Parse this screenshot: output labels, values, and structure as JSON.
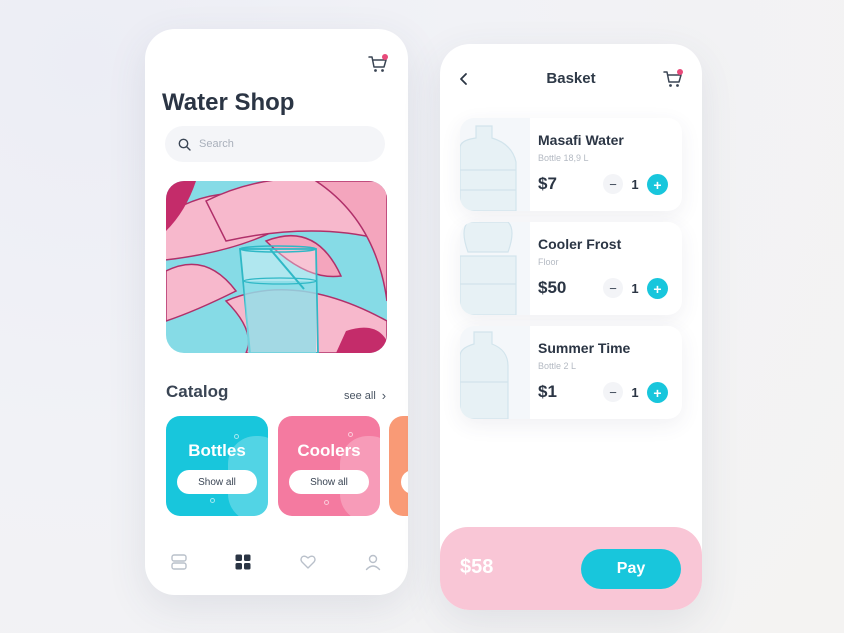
{
  "shop": {
    "title": "Water Shop",
    "search_placeholder": "Search",
    "catalog_title": "Catalog",
    "see_all": "see all",
    "categories": [
      {
        "name": "Bottles",
        "button": "Show all",
        "color": "#18c6dc"
      },
      {
        "name": "Coolers",
        "button": "Show all",
        "color": "#f47aa0"
      },
      {
        "name": "",
        "button": "",
        "color": "#f99a76"
      }
    ],
    "nav": [
      "list-icon",
      "grid-icon",
      "heart-icon",
      "user-icon"
    ],
    "active_nav": "grid-icon"
  },
  "basket": {
    "title": "Basket",
    "items": [
      {
        "name": "Masafi Water",
        "sub": "Bottle 18,9 L",
        "price": "$7",
        "qty": "1"
      },
      {
        "name": "Cooler Frost",
        "sub": "Floor",
        "price": "$50",
        "qty": "1"
      },
      {
        "name": "Summer Time",
        "sub": "Bottle 2 L",
        "price": "$1",
        "qty": "1"
      }
    ],
    "total": "$58",
    "pay_label": "Pay"
  },
  "icons": {
    "minus": "−",
    "plus": "+",
    "chevron": "›"
  },
  "colors": {
    "accent": "#18c6dc",
    "pink": "#f47aa0",
    "badge": "#e84a7a"
  }
}
